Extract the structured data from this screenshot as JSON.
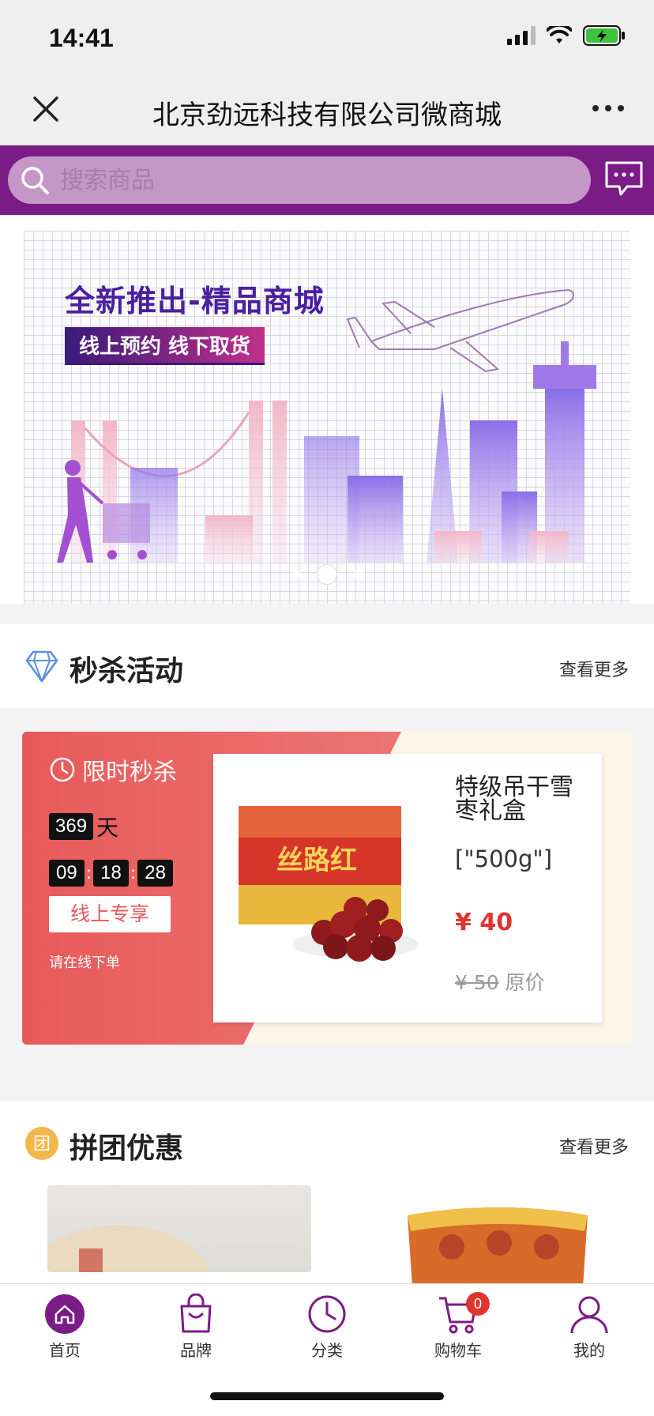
{
  "status_bar": {
    "time": "14:41"
  },
  "nav": {
    "title": "北京劲远科技有限公司微商城"
  },
  "search": {
    "placeholder": "搜索商品"
  },
  "banner": {
    "title": "全新推出-精品商城",
    "tag": "线上预约 线下取货",
    "dots": 3,
    "active_dot": 2
  },
  "flash_section": {
    "title": "秒杀活动",
    "more": "查看更多",
    "label": "限时秒杀",
    "days": "369",
    "day_unit": "天",
    "hours": "09",
    "minutes": "18",
    "seconds": "28",
    "button": "线上专享",
    "note": "请在线下单",
    "product": {
      "name": "特级吊干雪枣礼盒",
      "spec": "[\"500g\"]",
      "price": "¥ 40",
      "original_price": "¥ 50",
      "original_label": "原价"
    }
  },
  "group_section": {
    "title": "拼团优惠",
    "more": "查看更多",
    "icon_char": "团"
  },
  "tabs": [
    {
      "label": "首页",
      "icon": "home-icon",
      "active": true
    },
    {
      "label": "品牌",
      "icon": "bag-icon"
    },
    {
      "label": "分类",
      "icon": "clock-icon"
    },
    {
      "label": "购物车",
      "icon": "cart-icon",
      "badge": "0"
    },
    {
      "label": "我的",
      "icon": "user-icon"
    }
  ],
  "colors": {
    "brand_purple": "#7b1b86",
    "flash_red": "#e85a5a",
    "price_red": "#e0342e",
    "group_icon": "#f2b84b"
  }
}
